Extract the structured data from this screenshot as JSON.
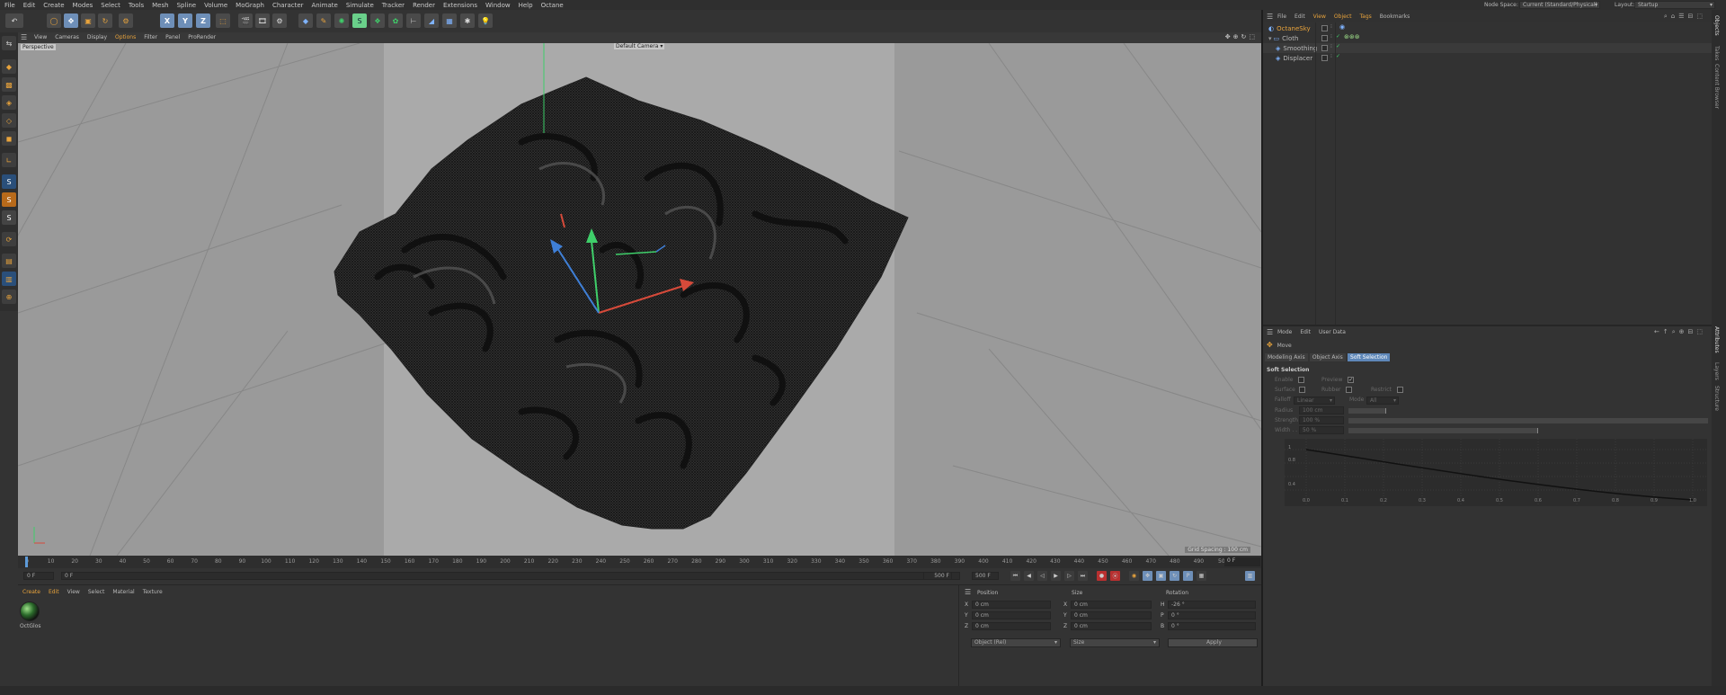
{
  "menubar": {
    "items": [
      "File",
      "Edit",
      "Create",
      "Modes",
      "Select",
      "Tools",
      "Mesh",
      "Spline",
      "Volume",
      "MoGraph",
      "Character",
      "Animate",
      "Simulate",
      "Tracker",
      "Render",
      "Extensions",
      "Window",
      "Help",
      "Octane"
    ],
    "node_space_label": "Node Space:",
    "node_space_value": "Current (Standard/Physical)",
    "layout_label": "Layout:",
    "layout_value": "Startup"
  },
  "toolbar": {
    "icons": [
      "undo-icon",
      "live-selection-icon",
      "move-icon",
      "scale-icon",
      "rotate-icon",
      "recent-tools-icon",
      "x-axis-icon",
      "y-axis-icon",
      "z-axis-icon",
      "coordinate-system-icon",
      "render-view-icon",
      "render-picture-viewer-icon",
      "render-settings-icon",
      "cube-icon",
      "pen-icon",
      "subdivision-icon",
      "bend-icon",
      "cloner-icon",
      "volume-builder-icon",
      "symmetry-icon",
      "floor-icon",
      "camera-icon",
      "light-icon"
    ]
  },
  "left_tools": {
    "icons": [
      "make-editable-icon",
      "model-mode-icon",
      "texture-mode-icon",
      "points-mode-icon",
      "edges-mode-icon",
      "polygons-mode-icon",
      "uv-mode-icon",
      "axis-mode-icon",
      "enable-snap-icon",
      "snap-settings-icon",
      "workplane-icon",
      "octane-live-icon",
      "octane-object-icon",
      "octane-settings-icon",
      "octane-material-icon"
    ],
    "letters": [
      "S",
      "S",
      "S"
    ]
  },
  "viewport": {
    "menu": [
      "View",
      "Cameras",
      "Display",
      "Options",
      "Filter",
      "Panel",
      "ProRender"
    ],
    "view_name": "Perspective",
    "camera_label": "Default Camera",
    "grid_spacing": "Grid Spacing : 100 cm"
  },
  "object_manager": {
    "menu": [
      "File",
      "Edit",
      "View",
      "Object",
      "Tags",
      "Bookmarks"
    ],
    "objects": [
      {
        "name": "OctaneSky",
        "level": 0
      },
      {
        "name": "Cloth",
        "level": 0
      },
      {
        "name": "Smoothing",
        "level": 1
      },
      {
        "name": "Displacer",
        "level": 1
      }
    ],
    "right_tabs": [
      "Objects",
      "Takes",
      "Content Browser"
    ]
  },
  "attributes": {
    "menu": [
      "Mode",
      "Edit",
      "User Data"
    ],
    "tool_title": "Move",
    "tabs": [
      "Modeling Axis",
      "Object Axis",
      "Soft Selection"
    ],
    "active_tab": "Soft Selection",
    "section": "Soft Selection",
    "enable_label": "Enable",
    "preview_label": "Preview",
    "surface_label": "Surface",
    "rubber_label": "Rubber",
    "restrict_label": "Restrict",
    "falloff_label": "Falloff",
    "falloff_value": "Linear",
    "mode_label": "Mode",
    "mode_value": "All",
    "radius_label": "Radius",
    "radius_value": "100 cm",
    "strength_label": "Strength",
    "strength_value": "100 %",
    "width_label": "Width . . .",
    "width_value": "50 %",
    "graph_y_labels": [
      "1",
      "0.8",
      "0.4"
    ],
    "graph_x_labels": [
      "0.0",
      "0.1",
      "0.2",
      "0.3",
      "0.4",
      "0.5",
      "0.6",
      "0.7",
      "0.8",
      "0.9",
      "1.0"
    ],
    "right_tabs": [
      "Attributes",
      "Layers",
      "Structure"
    ]
  },
  "timeline": {
    "ticks": [
      "0",
      "10",
      "20",
      "30",
      "40",
      "50",
      "60",
      "70",
      "80",
      "90",
      "100",
      "110",
      "120",
      "130",
      "140",
      "150",
      "160",
      "170",
      "180",
      "190",
      "200",
      "210",
      "220",
      "230",
      "240",
      "250",
      "260",
      "270",
      "280",
      "290",
      "300",
      "310",
      "320",
      "330",
      "340",
      "350",
      "360",
      "370",
      "380",
      "390",
      "400",
      "410",
      "420",
      "430",
      "440",
      "450",
      "460",
      "470",
      "480",
      "490",
      "50("
    ],
    "current_frame": "0 F",
    "start_frame": "0 F",
    "start_field": "0 F",
    "end_field": "500 F",
    "end_field2": "500 F"
  },
  "material_manager": {
    "menu": [
      "Create",
      "Edit",
      "View",
      "Select",
      "Material",
      "Texture"
    ],
    "materials": [
      {
        "name": "OctGlos"
      }
    ]
  },
  "coordinates": {
    "headers": [
      "Position",
      "Size",
      "Rotation"
    ],
    "rows": [
      {
        "pos_axis": "X",
        "pos": "0 cm",
        "size_axis": "X",
        "size": "0 cm",
        "rot_axis": "H",
        "rot": "-26 °"
      },
      {
        "pos_axis": "Y",
        "pos": "0 cm",
        "size_axis": "Y",
        "size": "0 cm",
        "rot_axis": "P",
        "rot": "0 °"
      },
      {
        "pos_axis": "Z",
        "pos": "0 cm",
        "size_axis": "Z",
        "size": "0 cm",
        "rot_axis": "B",
        "rot": "0 °"
      }
    ],
    "mode_value": "Object (Rel)",
    "size_mode": "Size",
    "apply_label": "Apply"
  },
  "colors": {
    "accent_orange": "#e8a33c",
    "selection_blue": "#8ab3e6",
    "axis_x": "#d64a3a",
    "axis_y": "#3fcf6a",
    "axis_z": "#3f7fd6"
  }
}
